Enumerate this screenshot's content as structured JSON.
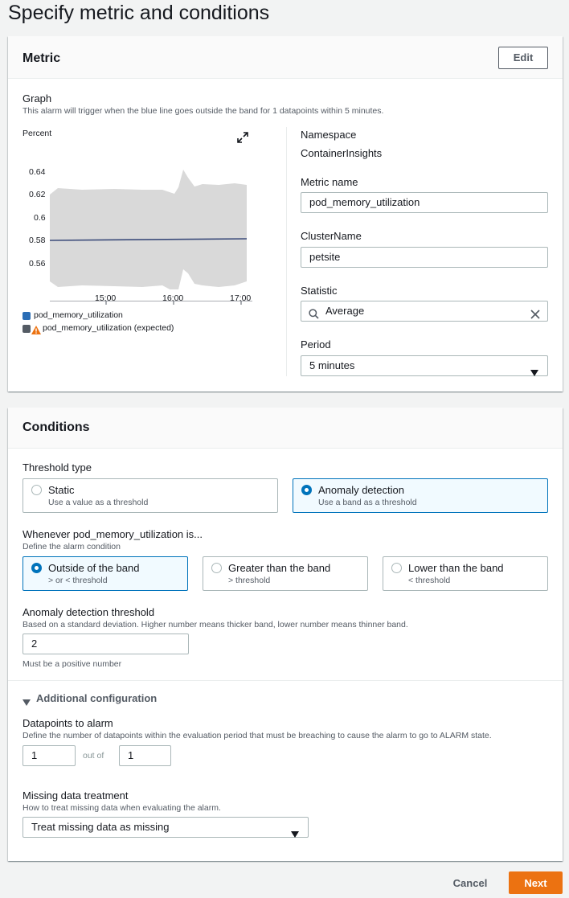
{
  "page_title": "Specify metric and conditions",
  "metric": {
    "header": "Metric",
    "edit_label": "Edit",
    "graph_label": "Graph",
    "graph_desc": "This alarm will trigger when the blue line goes outside the band for 1 datapoints within 5 minutes.",
    "chart_data": {
      "type": "area",
      "ylabel": "Percent",
      "y_ticks": [
        "0.64",
        "0.62",
        "0.6",
        "0.58",
        "0.56"
      ],
      "x_ticks": [
        "15:00",
        "16:00",
        "17:00"
      ],
      "series": [
        {
          "name": "pod_memory_utilization",
          "color": "#1f5f9e"
        },
        {
          "name": "pod_memory_utilization (expected)",
          "color": "#d9d9d9"
        }
      ]
    },
    "legend": [
      {
        "label": "pod_memory_utilization",
        "color": "#2a6db5"
      },
      {
        "label": "pod_memory_utilization (expected)",
        "color": "#545b64",
        "warning_color": "#ec7211"
      }
    ],
    "namespace_label": "Namespace",
    "namespace_value": "ContainerInsights",
    "metric_name_label": "Metric name",
    "metric_name_value": "pod_memory_utilization",
    "cluster_label": "ClusterName",
    "cluster_value": "petsite",
    "statistic_label": "Statistic",
    "statistic_value": "Average",
    "period_label": "Period",
    "period_value": "5 minutes"
  },
  "conditions": {
    "header": "Conditions",
    "threshold_type_label": "Threshold type",
    "threshold_types": [
      {
        "title": "Static",
        "desc": "Use a value as a threshold",
        "selected": false
      },
      {
        "title": "Anomaly detection",
        "desc": "Use a band as a threshold",
        "selected": true
      }
    ],
    "whenever_label": "Whenever pod_memory_utilization is...",
    "whenever_desc": "Define the alarm condition",
    "band_options": [
      {
        "title": "Outside of the band",
        "desc": "> or < threshold",
        "selected": true
      },
      {
        "title": "Greater than the band",
        "desc": "> threshold",
        "selected": false
      },
      {
        "title": "Lower than the band",
        "desc": "< threshold",
        "selected": false
      }
    ],
    "anomaly_label": "Anomaly detection threshold",
    "anomaly_desc": "Based on a standard deviation. Higher number means thicker band, lower number means thinner band.",
    "anomaly_value": "2",
    "anomaly_hint": "Must be a positive number",
    "additional_label": "Additional configuration",
    "datapoints_label": "Datapoints to alarm",
    "datapoints_desc": "Define the number of datapoints within the evaluation period that must be breaching to cause the alarm to go to ALARM state.",
    "datapoints_value": "1",
    "out_of_label": "out of",
    "period_count_value": "1",
    "missing_label": "Missing data treatment",
    "missing_desc": "How to treat missing data when evaluating the alarm.",
    "missing_value": "Treat missing data as missing"
  },
  "footer": {
    "cancel_label": "Cancel",
    "next_label": "Next"
  },
  "colors": {
    "primary": "#ec7211",
    "selected": "#0073bb"
  }
}
